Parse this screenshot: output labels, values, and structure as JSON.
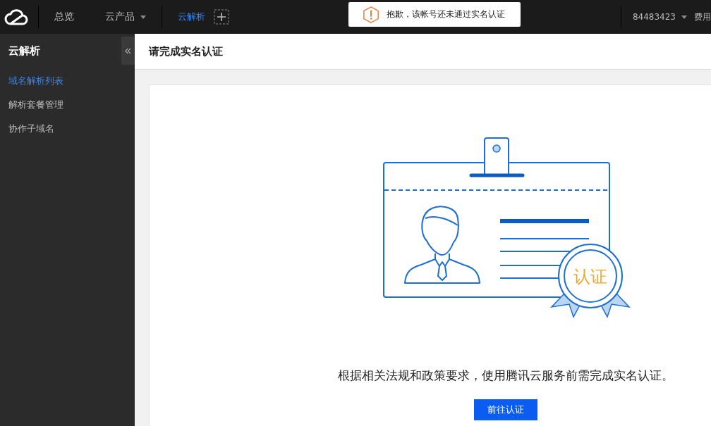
{
  "top_nav": {
    "items": [
      {
        "label": "总览",
        "kind": "link",
        "selected": false
      },
      {
        "label": "云产品",
        "kind": "dropdown",
        "selected": false
      },
      {
        "label": "云解析",
        "kind": "link",
        "selected": true
      }
    ],
    "toast": {
      "message": "抱歉，该帐号还未通过实名认证"
    },
    "account": "84483423",
    "fees": "费用"
  },
  "sidebar": {
    "title": "云解析",
    "items": [
      {
        "label": "域名解析列表",
        "selected": true
      },
      {
        "label": "解析套餐管理",
        "selected": false
      },
      {
        "label": "协作子域名",
        "selected": false
      }
    ]
  },
  "page": {
    "title": "请完成实名认证",
    "seal_text": "认证",
    "message": "根据相关法规和政策要求，使用腾讯云服务前需完成实名认证。",
    "button": "前往认证"
  }
}
